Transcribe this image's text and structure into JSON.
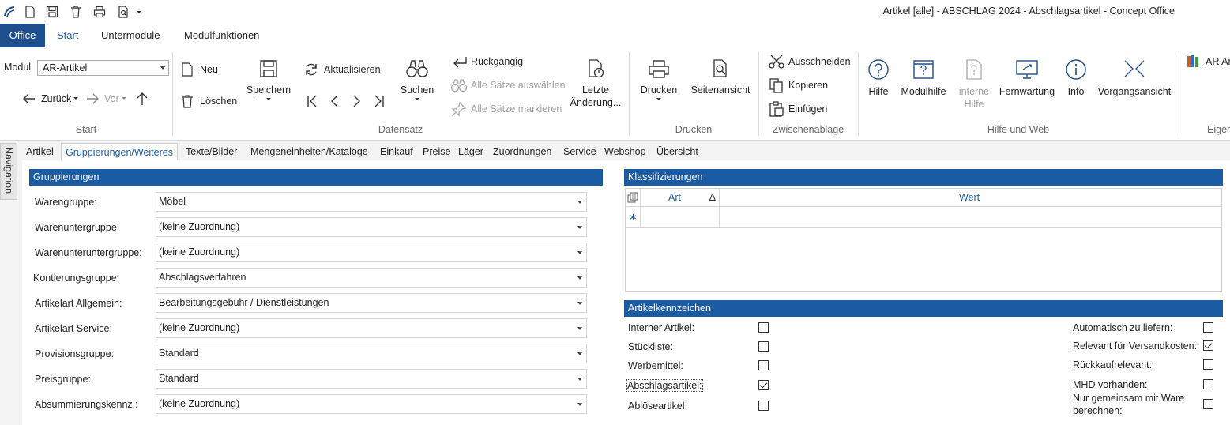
{
  "window": {
    "title": "Artikel [alle] - ABSCHLAG 2024 - Abschlagsartikel - Concept Office"
  },
  "menu_tabs": [
    {
      "label": "Office"
    },
    {
      "label": "Start"
    },
    {
      "label": "Untermodule"
    },
    {
      "label": "Modulfunktionen"
    }
  ],
  "ribbon": {
    "start": {
      "modul_label": "Modul",
      "modul_value": "AR-Artikel",
      "back": "Zurück",
      "forward": "Vor",
      "group": "Start"
    },
    "datensatz": {
      "neu": "Neu",
      "loeschen": "Löschen",
      "speichern": "Speichern",
      "aktualisieren": "Aktualisieren",
      "suchen": "Suchen",
      "rueckgaengig": "Rückgängig",
      "alle_auswaehlen": "Alle Sätze auswählen",
      "alle_markieren": "Alle Sätze markieren",
      "letzte_1": "Letzte",
      "letzte_2": "Änderung...",
      "group": "Datensatz"
    },
    "drucken": {
      "drucken": "Drucken",
      "seitenansicht": "Seitenansicht",
      "group": "Drucken"
    },
    "zwischenablage": {
      "ausschneiden": "Ausschneiden",
      "kopieren": "Kopieren",
      "einfuegen": "Einfügen",
      "group": "Zwischenablage"
    },
    "hilfe": {
      "hilfe": "Hilfe",
      "modulhilfe": "Modulhilfe",
      "interne_1": "interne",
      "interne_2": "Hilfe",
      "fernwartung": "Fernwartung",
      "info": "Info",
      "vorgangsansicht": "Vorgangsansicht",
      "group": "Hilfe und Web"
    },
    "eigen": {
      "ar": "AR Ar",
      "group": "Eigen"
    }
  },
  "navigation": {
    "label": "Navigation"
  },
  "content_tabs": [
    {
      "label": "Artikel"
    },
    {
      "label": "Gruppierungen/Weiteres"
    },
    {
      "label": "Texte/Bilder"
    },
    {
      "label": "Mengeneinheiten/Kataloge"
    },
    {
      "label": "Einkauf"
    },
    {
      "label": "Preise"
    },
    {
      "label": "Läger"
    },
    {
      "label": "Zuordnungen"
    },
    {
      "label": "Service"
    },
    {
      "label": "Webshop"
    },
    {
      "label": "Übersicht"
    }
  ],
  "gruppierungen": {
    "title": "Gruppierungen",
    "rows": [
      {
        "label": "Warengruppe:",
        "value": "Möbel"
      },
      {
        "label": "Warenuntergruppe:",
        "value": "(keine Zuordnung)"
      },
      {
        "label": "Warenunteruntergruppe:",
        "value": "(keine Zuordnung)"
      },
      {
        "label": "Kontierungsgruppe:",
        "value": "Abschlagsverfahren"
      },
      {
        "label": "Artikelart Allgemein:",
        "value": "Bearbeitungsgebühr / Dienstleistungen"
      },
      {
        "label": "Artikelart Service:",
        "value": "(keine Zuordnung)"
      },
      {
        "label": "Provisionsgruppe:",
        "value": "Standard"
      },
      {
        "label": "Preisgruppe:",
        "value": "Standard"
      },
      {
        "label": "Absummierungskennz.:",
        "value": "(keine Zuordnung)"
      }
    ]
  },
  "klassifizierungen": {
    "title": "Klassifizierungen",
    "columns": {
      "art": "Art",
      "wert": "Wert"
    },
    "sort_glyph": "∆",
    "new_row_glyph": "∗"
  },
  "artikelkennzeichen": {
    "title": "Artikelkennzeichen",
    "left": [
      {
        "label": "Interner Artikel:",
        "checked": false
      },
      {
        "label": "Stückliste:",
        "checked": false
      },
      {
        "label": "Werbemittel:",
        "checked": false
      },
      {
        "label": "Abschlagsartikel:",
        "checked": true
      },
      {
        "label": "Ablöseartikel:",
        "checked": false
      }
    ],
    "right": [
      {
        "label": "Automatisch zu liefern:",
        "checked": false
      },
      {
        "label": "Relevant für Versandkosten:",
        "checked": true
      },
      {
        "label": "Rückkaufrelevant:",
        "checked": false
      },
      {
        "label": "MHD vorhanden:",
        "checked": false
      },
      {
        "label_1": "Nur gemeinsam mit Ware",
        "label_2": "berechnen:",
        "checked": false
      }
    ]
  }
}
